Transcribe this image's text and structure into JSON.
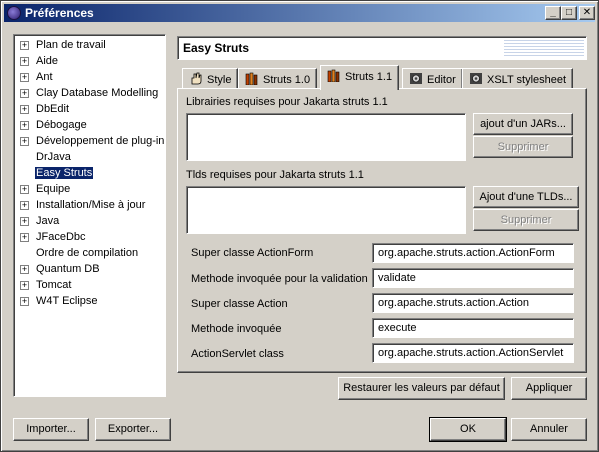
{
  "window": {
    "title": "Préférences"
  },
  "tree": {
    "items": [
      {
        "label": "Plan de travail",
        "expandable": true
      },
      {
        "label": "Aide",
        "expandable": true
      },
      {
        "label": "Ant",
        "expandable": true
      },
      {
        "label": "Clay Database Modelling",
        "expandable": true
      },
      {
        "label": "DbEdit",
        "expandable": true
      },
      {
        "label": "Débogage",
        "expandable": true
      },
      {
        "label": "Développement de plug-in",
        "expandable": true
      },
      {
        "label": "DrJava",
        "expandable": false
      },
      {
        "label": "Easy Struts",
        "expandable": false,
        "selected": true
      },
      {
        "label": "Equipe",
        "expandable": true
      },
      {
        "label": "Installation/Mise à jour",
        "expandable": true
      },
      {
        "label": "Java",
        "expandable": true
      },
      {
        "label": "JFaceDbc",
        "expandable": true
      },
      {
        "label": "Ordre de compilation",
        "expandable": false
      },
      {
        "label": "Quantum DB",
        "expandable": true
      },
      {
        "label": "Tomcat",
        "expandable": true
      },
      {
        "label": "W4T Eclipse",
        "expandable": true
      }
    ]
  },
  "page": {
    "title": "Easy Struts"
  },
  "tabs": [
    {
      "label": "Style"
    },
    {
      "label": "Struts 1.0"
    },
    {
      "label": "Struts 1.1",
      "active": true
    },
    {
      "label": "Editor"
    },
    {
      "label": "XSLT stylesheet"
    }
  ],
  "struts11": {
    "libs_label": "Librairies requises pour Jakarta struts 1.1",
    "add_jars_button": "ajout d'un JARs...",
    "remove_libs_button": "Supprimer",
    "tlds_label": "Tlds requises pour Jakarta struts 1.1",
    "add_tlds_button": "Ajout d'une TLDs...",
    "remove_tlds_button": "Supprimer",
    "fields": [
      {
        "label": "Super classe ActionForm",
        "value": "org.apache.struts.action.ActionForm"
      },
      {
        "label": "Methode invoquée pour la validation",
        "value": "validate"
      },
      {
        "label": "Super classe Action",
        "value": "org.apache.struts.action.Action"
      },
      {
        "label": "Methode invoquée",
        "value": "execute"
      },
      {
        "label": "ActionServlet class",
        "value": "org.apache.struts.action.ActionServlet"
      }
    ]
  },
  "buttons": {
    "restore_defaults": "Restaurer les valeurs par défaut",
    "apply": "Appliquer",
    "import": "Importer...",
    "export": "Exporter...",
    "ok": "OK",
    "cancel": "Annuler"
  },
  "colors": {
    "title_active": "#0a246a",
    "selection": "#0a246a",
    "face": "#d4d0c8"
  }
}
